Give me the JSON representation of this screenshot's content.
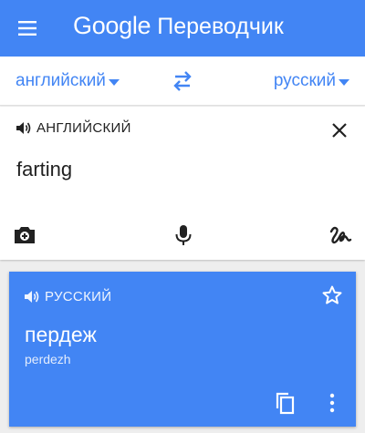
{
  "app": {
    "brand": "Google",
    "product": "Переводчик"
  },
  "languages": {
    "source": "английский",
    "target": "русский"
  },
  "input": {
    "language_label": "АНГЛИЙСКИЙ",
    "text": "farting"
  },
  "result": {
    "language_label": "РУССКИЙ",
    "translation": "пердеж",
    "transliteration": "perdezh"
  },
  "icons": {
    "menu": "hamburger-menu-icon",
    "swap": "swap-languages-icon",
    "speaker": "speaker-icon",
    "clear": "close-icon",
    "camera": "camera-icon",
    "mic": "microphone-icon",
    "handwriting": "handwriting-icon",
    "star": "star-outline-icon",
    "copy": "copy-icon",
    "more": "more-vertical-icon"
  },
  "colors": {
    "brand_blue": "#4285f4",
    "text_dark": "#212121",
    "background": "#eeeeee"
  }
}
